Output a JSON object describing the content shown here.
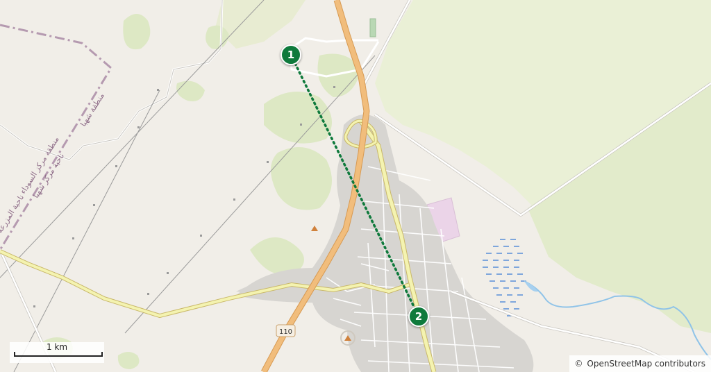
{
  "map": {
    "markers": [
      {
        "label": "1"
      },
      {
        "label": "2"
      }
    ],
    "route_style": "dotted",
    "route_color": "#0f7a3c",
    "road_shield": "110",
    "boundary_labels": [
      "منطقة مركز السوداء",
      "منطقة شهبا",
      "ناحية مركز شهبا",
      "ناحية المزرعة"
    ],
    "scale": {
      "label": "1 km"
    },
    "attribution": {
      "symbol": "©",
      "text": "OpenStreetMap contributors"
    },
    "colors": {
      "background": "#f1eee8",
      "greenland": "#eaf0d6",
      "scrub": "#dde8c4",
      "urban": "#d7d5d1",
      "primary_road": "#f1bd7c",
      "secondary_road": "#f4f3b0",
      "water": "#8fc3e8",
      "boundary": "#b59ab0",
      "industrial": "#ebd4e8"
    }
  }
}
